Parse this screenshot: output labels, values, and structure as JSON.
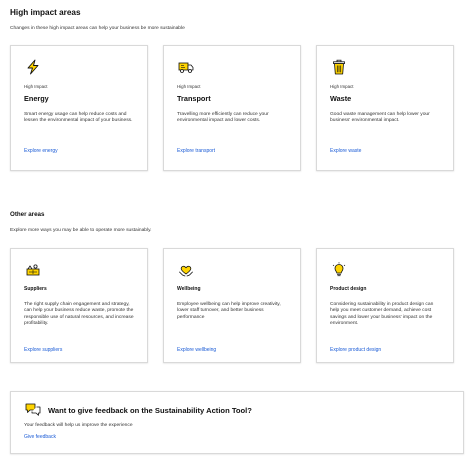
{
  "high_impact": {
    "title": "High impact areas",
    "intro": "Changes in these high impact areas can help your business be more sustainable",
    "cards": [
      {
        "icon": "lightning-icon",
        "eyebrow": "High Impact",
        "title": "Energy",
        "description": "Smart energy usage can help reduce costs and lessen the environmental impact of your business.",
        "link": "Explore energy"
      },
      {
        "icon": "truck-icon",
        "eyebrow": "High Impact",
        "title": "Transport",
        "description": "Travelling more efficiently can reduce your environmental impact and lower costs.",
        "link": "Explore transport"
      },
      {
        "icon": "bin-icon",
        "eyebrow": "High Impact",
        "title": "Waste",
        "description": "Good waste management can help lower your business' environmental impact.",
        "link": "Explore waste"
      }
    ]
  },
  "other": {
    "title": "Other areas",
    "intro": "Explore more ways you may be able to operate more sustainably.",
    "cards": [
      {
        "icon": "supply-chain-icon",
        "title": "Suppliers",
        "description": "The right supply chain engagement and strategy, can help your business reduce waste, promote the responsible use of natural resources, and increase profitability.",
        "link": "Explore suppliers"
      },
      {
        "icon": "heart-hands-icon",
        "title": "Wellbeing",
        "description": "Employee wellbeing can help improve creativity, lower staff turnover, and better business performance",
        "link": "Explore wellbeing"
      },
      {
        "icon": "lightbulb-icon",
        "title": "Product design",
        "description": "Considering sustainability in product design can help you meet customer demand, achieve cost savings and lower your business' impact on the environment.",
        "link": "Explore product design"
      }
    ]
  },
  "feedback": {
    "icon": "chat-bubbles-icon",
    "title": "Want to give feedback on the Sustainability Action Tool?",
    "description": "Your feedback will help us improve the experience",
    "link": "Give feedback"
  },
  "colors": {
    "accent_yellow": "#ffd400",
    "link_blue": "#1a5bd6",
    "border": "#d9d9d9"
  }
}
